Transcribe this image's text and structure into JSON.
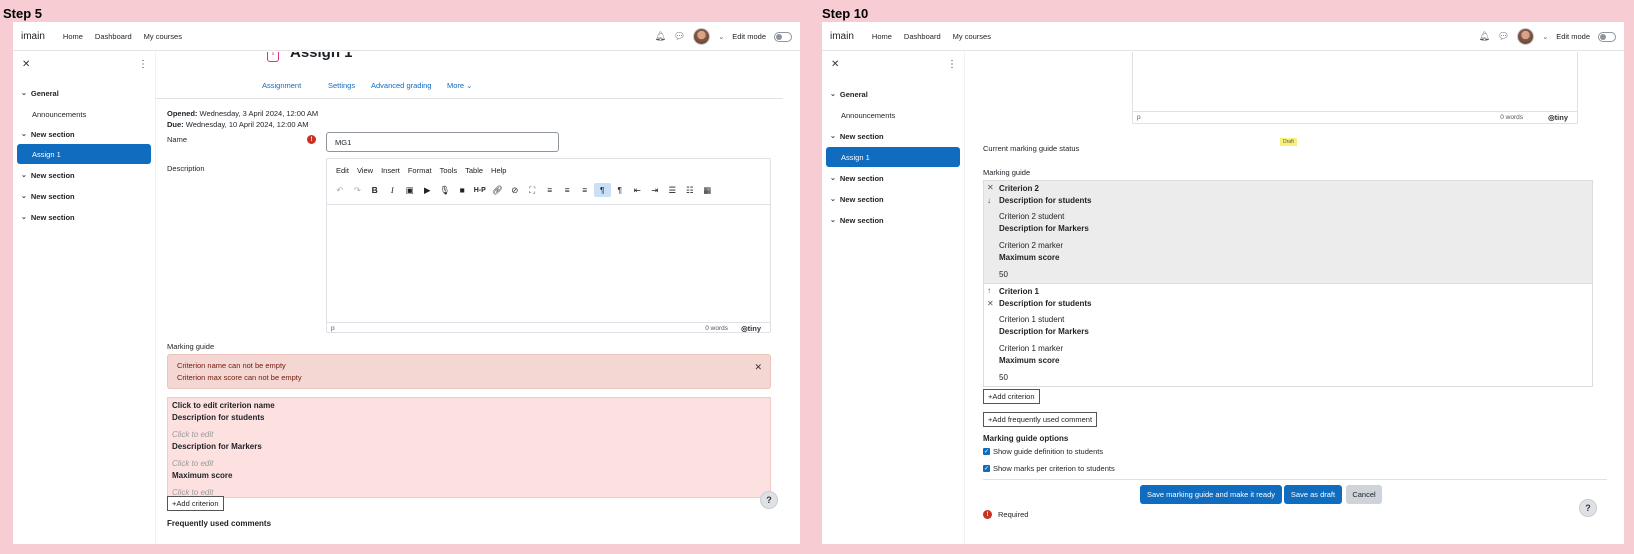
{
  "left": {
    "step_label": "Step 5",
    "navbar": {
      "brand": "imain",
      "links": [
        "Home",
        "Dashboard",
        "My courses"
      ],
      "edit_mode": "Edit mode"
    },
    "drawer": {
      "items": [
        "General",
        "Announcements",
        "New section",
        "Assign 1",
        "New section",
        "New section",
        "New section"
      ]
    },
    "page_title": "Assign 1",
    "tabs": [
      "Assignment",
      "Settings",
      "Advanced grading",
      "More"
    ],
    "opened_label": "Opened:",
    "opened_value": "Wednesday, 3 April 2024, 12:00 AM",
    "due_label": "Due:",
    "due_value": "Wednesday, 10 April 2024, 12:00 AM",
    "name_label": "Name",
    "name_value": "MG1",
    "description_label": "Description",
    "editor_menu": [
      "Edit",
      "View",
      "Insert",
      "Format",
      "Tools",
      "Table",
      "Help"
    ],
    "editor_status": {
      "path": "p",
      "words": "0 words",
      "brand": "tiny"
    },
    "marking_guide_label": "Marking guide",
    "alert": {
      "line1": "Criterion name can not be empty",
      "line2": "Criterion max score can not be empty"
    },
    "criterion": {
      "name": "Click to edit criterion name",
      "desc_students_label": "Description for students",
      "desc_students_placeholder": "Click to edit",
      "desc_markers_label": "Description for Markers",
      "desc_markers_placeholder": "Click to edit",
      "max_score_label": "Maximum score",
      "max_score_placeholder": "Click to edit"
    },
    "add_criterion": "Add criterion",
    "freq_comments_cut": "Frequently used comments"
  },
  "right": {
    "step_label": "Step 10",
    "navbar": {
      "brand": "imain",
      "links": [
        "Home",
        "Dashboard",
        "My courses"
      ],
      "edit_mode": "Edit mode"
    },
    "drawer": {
      "items": [
        "General",
        "Announcements",
        "New section",
        "Assign 1",
        "New section",
        "New section",
        "New section"
      ]
    },
    "editor_status": {
      "path": "p",
      "words": "0 words",
      "brand": "tiny"
    },
    "status_label": "Current marking guide status",
    "status_badge": "Draft",
    "marking_guide_label": "Marking guide",
    "criteria": [
      {
        "name": "Criterion 2",
        "desc_students_label": "Description for students",
        "desc_students": "Criterion 2 student",
        "desc_markers_label": "Description for Markers",
        "desc_markers": "Criterion 2 marker",
        "max_score_label": "Maximum score",
        "max_score": "50"
      },
      {
        "name": "Criterion 1",
        "desc_students_label": "Description for students",
        "desc_students": "Criterion 1 student",
        "desc_markers_label": "Description for Markers",
        "desc_markers": "Criterion 1 marker",
        "max_score_label": "Maximum score",
        "max_score": "50"
      }
    ],
    "add_criterion": "Add criterion",
    "add_comment": "Add frequently used comment",
    "options_heading": "Marking guide options",
    "option1": "Show guide definition to students",
    "option2": "Show marks per criterion to students",
    "btn_save_ready": "Save marking guide and make it ready",
    "btn_save_draft": "Save as draft",
    "btn_cancel": "Cancel",
    "required": "Required"
  },
  "colors": {
    "background": "#f7cdd3",
    "primary": "#0f6cbf",
    "alert_bg": "#f4d6d2",
    "criterion_bg": "#fde1e1",
    "draft_badge": "#f8f07a"
  }
}
